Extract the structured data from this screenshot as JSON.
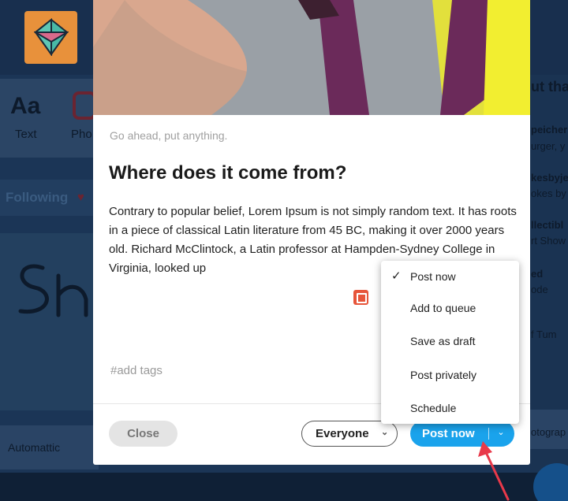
{
  "background": {
    "compose": {
      "text_label": "Text",
      "text_glyph": "Aa",
      "photo_label": "Pho"
    },
    "following_label": "Following",
    "automattic_label": "Automattic",
    "right_column": [
      "ut tha",
      "peicher",
      "urger, y",
      "kesbyje",
      "okes by",
      "llectibl",
      "rt Show",
      "ed",
      "ode",
      "f Tum",
      "otograp"
    ]
  },
  "modal": {
    "caption_hint": "Go ahead, put anything.",
    "heading": "Where does it come from?",
    "body": "Contrary to popular belief, Lorem Ipsum is not simply random text. It has roots in a piece of classical Latin literature from 45 BC, making it over 2000 years old. Richard McClintock, a Latin professor at Hampden-Sydney College in Virginia, looked up",
    "image_icon": "image-icon",
    "tags_placeholder": "#add tags",
    "footer": {
      "close_label": "Close",
      "audience_label": "Everyone",
      "post_label": "Post now"
    }
  },
  "post_menu": {
    "selected": "Post now",
    "items": [
      "Post now",
      "Add to queue",
      "Save as draft",
      "Post privately",
      "Schedule"
    ]
  },
  "colors": {
    "accent": "#1aa3ec",
    "arrow": "#e8394a",
    "logo": "#e8913b"
  }
}
